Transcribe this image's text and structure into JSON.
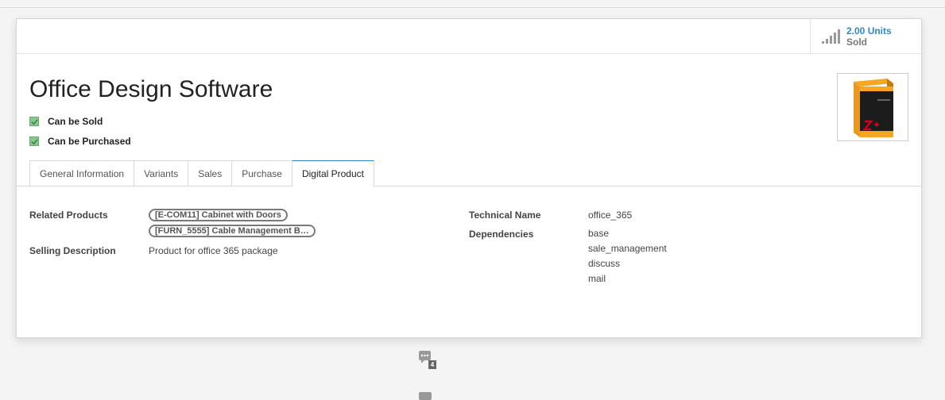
{
  "stat": {
    "value": "2.00 Units",
    "label": "Sold"
  },
  "product": {
    "title": "Office Design Software"
  },
  "checkboxes": [
    {
      "label": "Can be Sold",
      "checked": true
    },
    {
      "label": "Can be Purchased",
      "checked": true
    }
  ],
  "tabs": [
    {
      "label": "General Information",
      "active": false
    },
    {
      "label": "Variants",
      "active": false
    },
    {
      "label": "Sales",
      "active": false
    },
    {
      "label": "Purchase",
      "active": false
    },
    {
      "label": "Digital Product",
      "active": true
    }
  ],
  "fields": {
    "related_products_label": "Related Products",
    "related_products": [
      "[E-COM11] Cabinet with Doors",
      "[FURN_5555] Cable Management B…"
    ],
    "selling_description_label": "Selling Description",
    "selling_description": "Product for office 365 package",
    "technical_name_label": "Technical Name",
    "technical_name": "office_365",
    "dependencies_label": "Dependencies",
    "dependencies": [
      "base",
      "sale_management",
      "discuss",
      "mail"
    ]
  },
  "chatter": {
    "count": "4"
  },
  "colors": {
    "accent": "#2f89c8",
    "checkbox": "#86c98c"
  },
  "icons": {
    "stat": "bar-chart-signal-icon",
    "chatter": "comments-icon",
    "product_image": "software-box-image"
  }
}
